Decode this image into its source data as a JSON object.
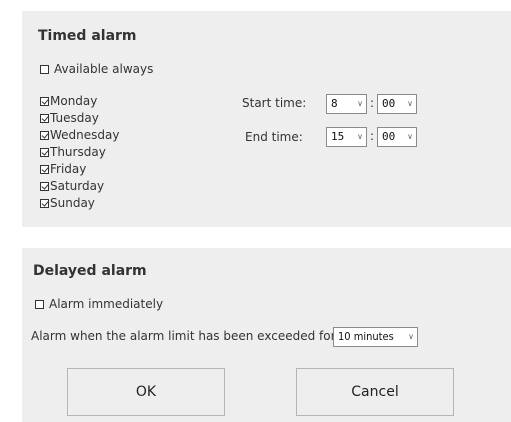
{
  "timed_alarm": {
    "title": "Timed alarm",
    "available_always": {
      "label": "Available always",
      "checked": false
    },
    "days": [
      {
        "label": "Monday",
        "checked": true
      },
      {
        "label": "Tuesday",
        "checked": true
      },
      {
        "label": "Wednesday",
        "checked": true
      },
      {
        "label": "Thursday",
        "checked": true
      },
      {
        "label": "Friday",
        "checked": true
      },
      {
        "label": "Saturday",
        "checked": true
      },
      {
        "label": "Sunday",
        "checked": true
      }
    ],
    "start_time": {
      "label": "Start time:",
      "hour": "8",
      "minute": "00"
    },
    "end_time": {
      "label": "End time:",
      "hour": "15",
      "minute": "00"
    },
    "separator": ":"
  },
  "delayed_alarm": {
    "title": "Delayed alarm",
    "alarm_immediately": {
      "label": "Alarm immediately",
      "checked": false
    },
    "exceeded_label": "Alarm when the alarm limit has been exceeded for",
    "delay_value": "10 minutes"
  },
  "buttons": {
    "ok": "OK",
    "cancel": "Cancel"
  },
  "icons": {
    "dropdown": "chevron-down-icon",
    "checkbox": "checkbox-icon"
  }
}
